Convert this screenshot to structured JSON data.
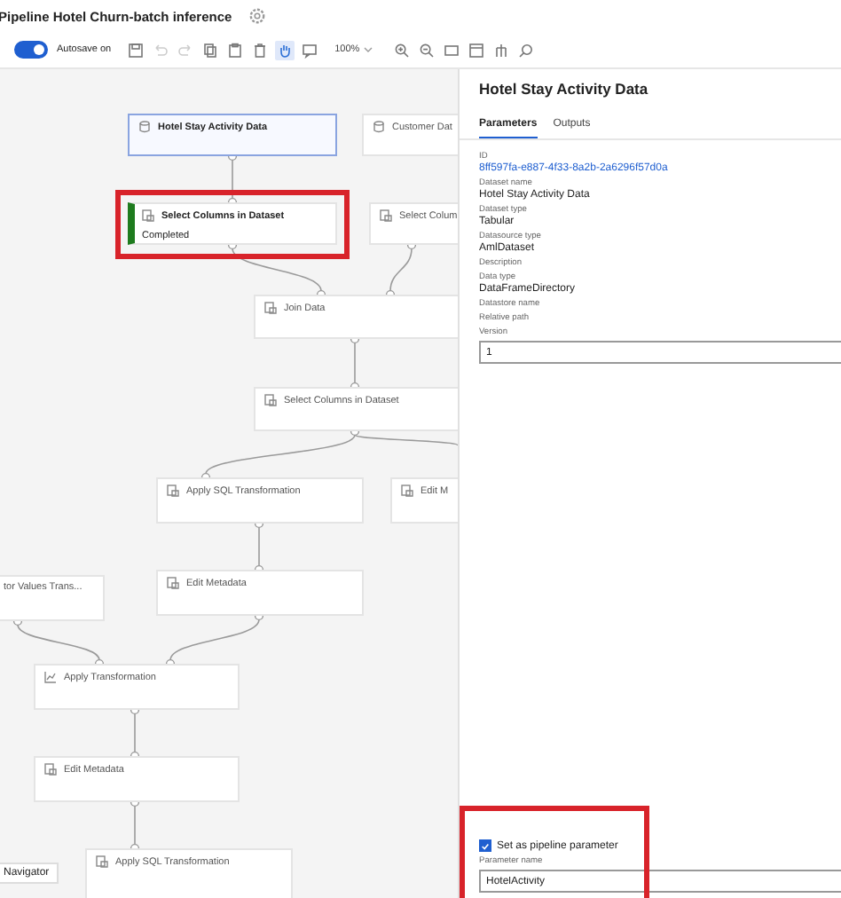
{
  "window": {
    "title": "Pipeline Hotel Churn-batch inference"
  },
  "toolbar": {
    "autosave": {
      "label": "Autosave on",
      "on": true
    },
    "zoom": "100%",
    "tools": [
      {
        "kind": "save",
        "disabled": false,
        "selected": false
      },
      {
        "kind": "undo",
        "disabled": true,
        "selected": false
      },
      {
        "kind": "redo",
        "disabled": true,
        "selected": false
      },
      {
        "kind": "copy",
        "disabled": false,
        "selected": false
      },
      {
        "kind": "paste",
        "disabled": false,
        "selected": false
      },
      {
        "kind": "delete",
        "disabled": false,
        "selected": false
      },
      {
        "kind": "pan",
        "disabled": false,
        "selected": true
      },
      {
        "kind": "comment",
        "disabled": false,
        "selected": false
      },
      {
        "kind": "zoom"
      },
      {
        "kind": "zoom-in",
        "disabled": false,
        "selected": false
      },
      {
        "kind": "zoom-out",
        "disabled": false,
        "selected": false
      },
      {
        "kind": "fit",
        "disabled": false,
        "selected": false
      },
      {
        "kind": "frame",
        "disabled": false,
        "selected": false
      },
      {
        "kind": "tree",
        "disabled": false,
        "selected": false
      },
      {
        "kind": "search",
        "disabled": false,
        "selected": false
      }
    ]
  },
  "canvas": {
    "nodes": [
      {
        "kind": "dataset",
        "label": "Hotel Stay Activity Data",
        "selected": true,
        "highlighted": false
      },
      {
        "kind": "dataset",
        "label": "Customer Dat",
        "selected": false,
        "highlighted": false
      },
      {
        "kind": "module",
        "label": "Select Columns in Dataset",
        "status": "Completed",
        "selected": false,
        "highlighted": true
      },
      {
        "kind": "module",
        "label": "Select Colum",
        "selected": false,
        "highlighted": false
      },
      {
        "kind": "module",
        "label": "Join Data",
        "selected": false,
        "highlighted": false
      },
      {
        "kind": "module",
        "label": "Select Columns in Dataset",
        "selected": false,
        "highlighted": false
      },
      {
        "kind": "module",
        "label": "Apply SQL Transformation",
        "selected": false,
        "highlighted": false
      },
      {
        "kind": "module",
        "label": "Edit M",
        "selected": false,
        "highlighted": false
      },
      {
        "label": "tor Values Trans...",
        "selected": false,
        "highlighted": false
      },
      {
        "kind": "module",
        "label": "Edit Metadata",
        "selected": false,
        "highlighted": false
      },
      {
        "kind": "transform",
        "label": "Apply Transformation",
        "selected": false,
        "highlighted": false
      },
      {
        "kind": "module",
        "label": "Edit Metadata",
        "selected": false,
        "highlighted": false
      },
      {
        "kind": "module",
        "label": "Apply SQL Transformation",
        "selected": false,
        "highlighted": false
      }
    ],
    "navigator": "Navigator"
  },
  "panel": {
    "title": "Hotel Stay Activity Data",
    "tabs": [
      {
        "label": "Parameters",
        "selected": true
      },
      {
        "label": "Outputs",
        "selected": false
      }
    ],
    "fields": [
      {
        "kind": "link",
        "label": "ID",
        "value": "8ff597fa-e887-4f33-8a2b-2a6296f57d0a"
      },
      {
        "kind": "text",
        "label": "Dataset name",
        "value": "Hotel Stay Activity Data"
      },
      {
        "kind": "text",
        "label": "Dataset type",
        "value": "Tabular"
      },
      {
        "kind": "text",
        "label": "Datasource type",
        "value": "AmlDataset"
      },
      {
        "kind": "empty",
        "label": "Description"
      },
      {
        "kind": "text",
        "label": "Data type",
        "value": "DataFrameDirectory"
      },
      {
        "kind": "empty",
        "label": "Datastore name"
      },
      {
        "kind": "empty",
        "label": "Relative path"
      },
      {
        "kind": "input",
        "label": "Version",
        "value": "1"
      }
    ],
    "pipeline_parameter": {
      "label": "Set as pipeline parameter",
      "checked": true,
      "highlighted": true,
      "name_label": "Parameter name",
      "value": "HotelActivity"
    }
  }
}
